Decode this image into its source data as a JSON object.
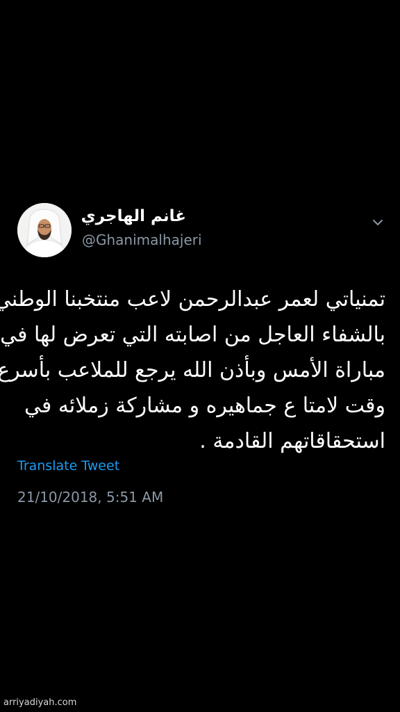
{
  "tweet": {
    "author": {
      "display_name": "غانم الهاجري",
      "handle": "@Ghanimalhajeri"
    },
    "menu_icon": "chevron-down-icon",
    "body_lines": [
      "تمنياتي لعمر عبدالرحمن لاعب منتخبنا الوطني",
      "بالشفاء العاجل من اصابته التي تعرض لها في",
      "مباراة الأمس وبأذن الله يرجع للملاعب بأسرع",
      "وقت لامتا ع جماهيره و مشاركة زملائه في",
      "استحقاقاتهم القادمة ."
    ],
    "translate_label": "Translate Tweet",
    "timestamp": "21/10/2018, 5:51 AM"
  },
  "watermark": "arriyadiyah.com",
  "colors": {
    "background": "#000000",
    "text": "#ffffff",
    "secondary_text": "#8b98a5",
    "link": "#1d9bf0"
  }
}
